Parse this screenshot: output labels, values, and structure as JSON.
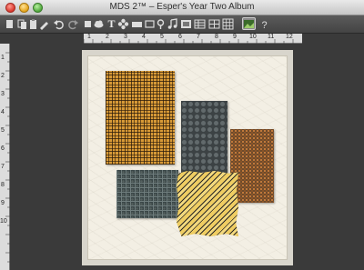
{
  "window": {
    "title": "MDS 2™ – Esper's Year Two Album"
  },
  "toolbar": {
    "tools": [
      {
        "name": "new-page-tool",
        "glyph": "▮"
      },
      {
        "name": "copy-tool",
        "glyph": "❐"
      },
      {
        "name": "paste-tool",
        "glyph": "📋"
      },
      {
        "name": "eyedropper-tool",
        "glyph": "✎"
      },
      {
        "name": "undo-tool",
        "glyph": "↶"
      },
      {
        "name": "redo-tool",
        "glyph": "↷"
      },
      {
        "name": "cloud-tool",
        "glyph": "☁"
      },
      {
        "name": "text-tool",
        "glyph": "T"
      },
      {
        "name": "embellishment-tool",
        "glyph": "✿"
      },
      {
        "name": "photo-box-tool",
        "glyph": "▬"
      },
      {
        "name": "slideshow-tool",
        "glyph": "▭"
      },
      {
        "name": "location-tool",
        "glyph": "⚲"
      },
      {
        "name": "music-tool",
        "glyph": "♫"
      },
      {
        "name": "photo-tool",
        "glyph": "▦"
      },
      {
        "name": "table-tool",
        "glyph": "▤"
      },
      {
        "name": "grid-tool",
        "glyph": "⊞"
      },
      {
        "name": "image-tool",
        "glyph": "▣"
      },
      {
        "name": "help-tool",
        "glyph": "?"
      }
    ]
  },
  "ruler_h": {
    "labels": [
      "1",
      "2",
      "3",
      "4",
      "5",
      "6",
      "7",
      "8",
      "9",
      "10",
      "11",
      "12"
    ]
  },
  "ruler_v": {
    "labels": [
      "1",
      "2",
      "3",
      "4",
      "5",
      "6",
      "7",
      "8",
      "9",
      "10"
    ]
  },
  "canvas": {
    "papers": [
      {
        "name": "plaid-paper",
        "pattern": "orange-plaid"
      },
      {
        "name": "circle-paper",
        "pattern": "gray-circles"
      },
      {
        "name": "copper-paper",
        "pattern": "copper-dots"
      },
      {
        "name": "grid-paper",
        "pattern": "teal-grid"
      },
      {
        "name": "stripe-paper",
        "pattern": "yellow-diagonal-stripes"
      }
    ]
  }
}
